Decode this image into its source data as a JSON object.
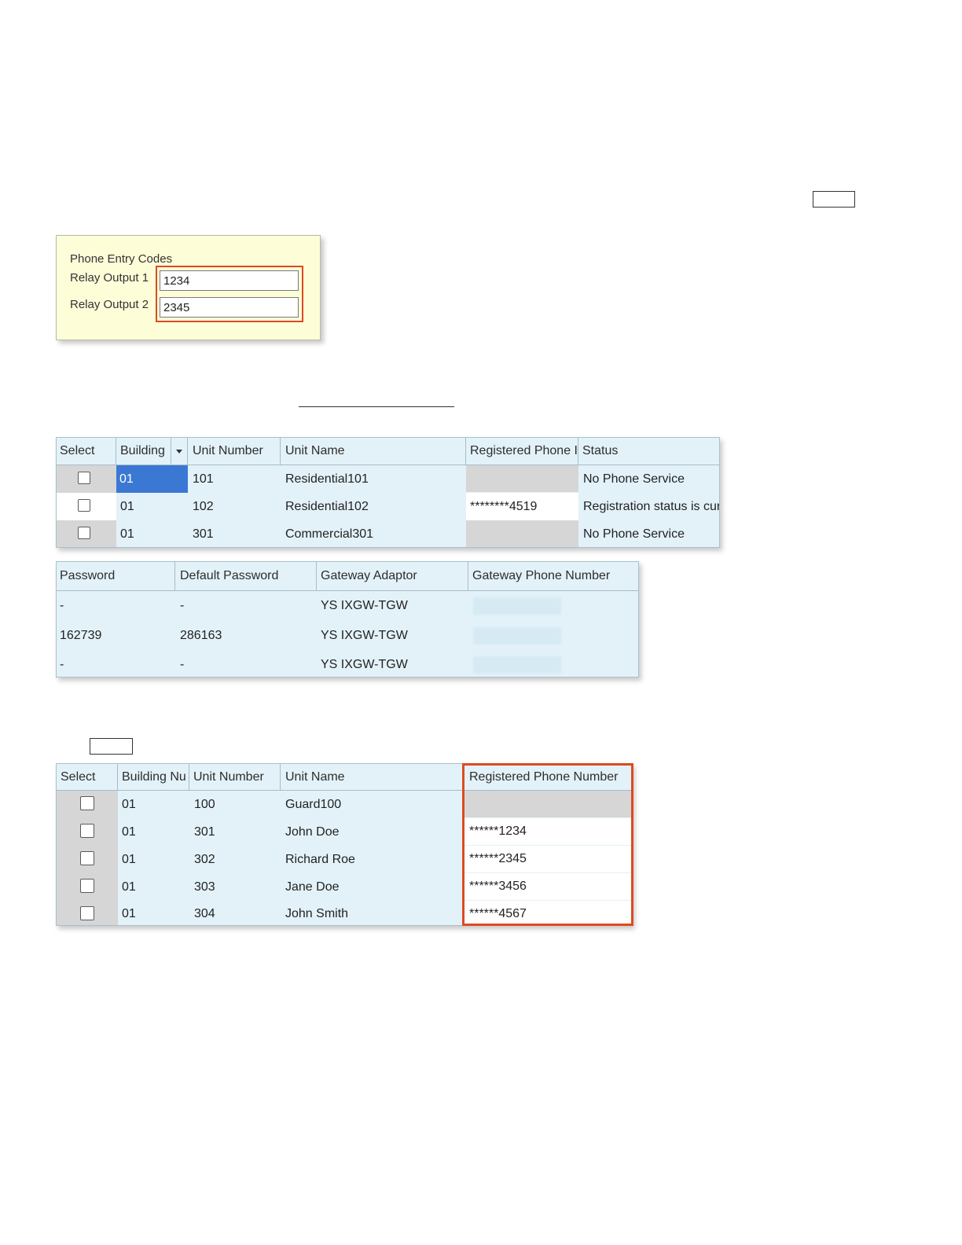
{
  "phone_entry_codes": {
    "title": "Phone Entry Codes",
    "relay1_label": "Relay Output 1",
    "relay1_value": "1234",
    "relay2_label": "Relay Output 2",
    "relay2_value": "2345"
  },
  "unit_table": {
    "headers": [
      "Select",
      "Building",
      "Unit Number",
      "Unit Name",
      "Registered Phone I",
      "Status"
    ],
    "rows": [
      {
        "building": "01",
        "unit_number": "101",
        "unit_name": "Residential101",
        "phone": "",
        "status": "No Phone Service"
      },
      {
        "building": "01",
        "unit_number": "102",
        "unit_name": "Residential102",
        "phone": "********4519",
        "status": "Registration status is cur"
      },
      {
        "building": "01",
        "unit_number": "301",
        "unit_name": "Commercial301",
        "phone": "",
        "status": "No Phone Service"
      }
    ]
  },
  "password_table": {
    "headers": [
      "Password",
      "Default Password",
      "Gateway Adaptor",
      "Gateway Phone Number"
    ],
    "rows": [
      {
        "password": "-",
        "default_password": "-",
        "gateway_adaptor": "YS IXGW-TGW"
      },
      {
        "password": "162739",
        "default_password": "286163",
        "gateway_adaptor": "YS IXGW-TGW"
      },
      {
        "password": "-",
        "default_password": "-",
        "gateway_adaptor": "YS IXGW-TGW"
      }
    ]
  },
  "registered_table": {
    "headers": [
      "Select",
      "Building Nu",
      "Unit Number",
      "Unit Name",
      "Registered Phone Number"
    ],
    "rows": [
      {
        "building": "01",
        "unit_number": "100",
        "unit_name": "Guard100",
        "phone": ""
      },
      {
        "building": "01",
        "unit_number": "301",
        "unit_name": "John Doe",
        "phone": "******1234"
      },
      {
        "building": "01",
        "unit_number": "302",
        "unit_name": "Richard Roe",
        "phone": "******2345"
      },
      {
        "building": "01",
        "unit_number": "303",
        "unit_name": "Jane Doe",
        "phone": "******3456"
      },
      {
        "building": "01",
        "unit_number": "304",
        "unit_name": "John Smith",
        "phone": "******4567"
      }
    ]
  },
  "colors": {
    "highlight": "#dd4a22",
    "grid_background": "#e3f2f9",
    "panel_background": "#fdfdd8",
    "selected_cell": "#3a78d4"
  },
  "icons": [
    "checkbox-icon",
    "dropdown-arrow-icon"
  ]
}
